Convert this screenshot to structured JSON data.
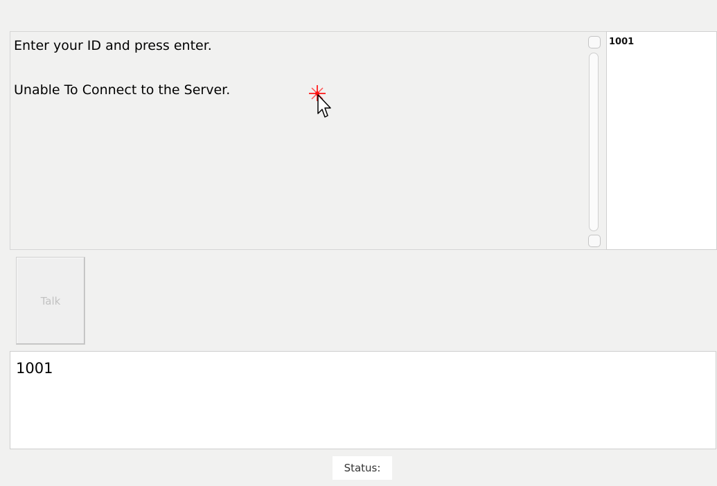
{
  "messages": [
    "Enter your ID and press enter.",
    "Unable To Connect to the Server."
  ],
  "user_list": {
    "items": [
      "1001"
    ]
  },
  "talk_button": {
    "label": "Talk"
  },
  "input": {
    "value": "1001"
  },
  "status": {
    "label": "Status:"
  },
  "cursor": {
    "icon": "arrow-cursor-icon",
    "highlight_color": "#ff2020"
  }
}
